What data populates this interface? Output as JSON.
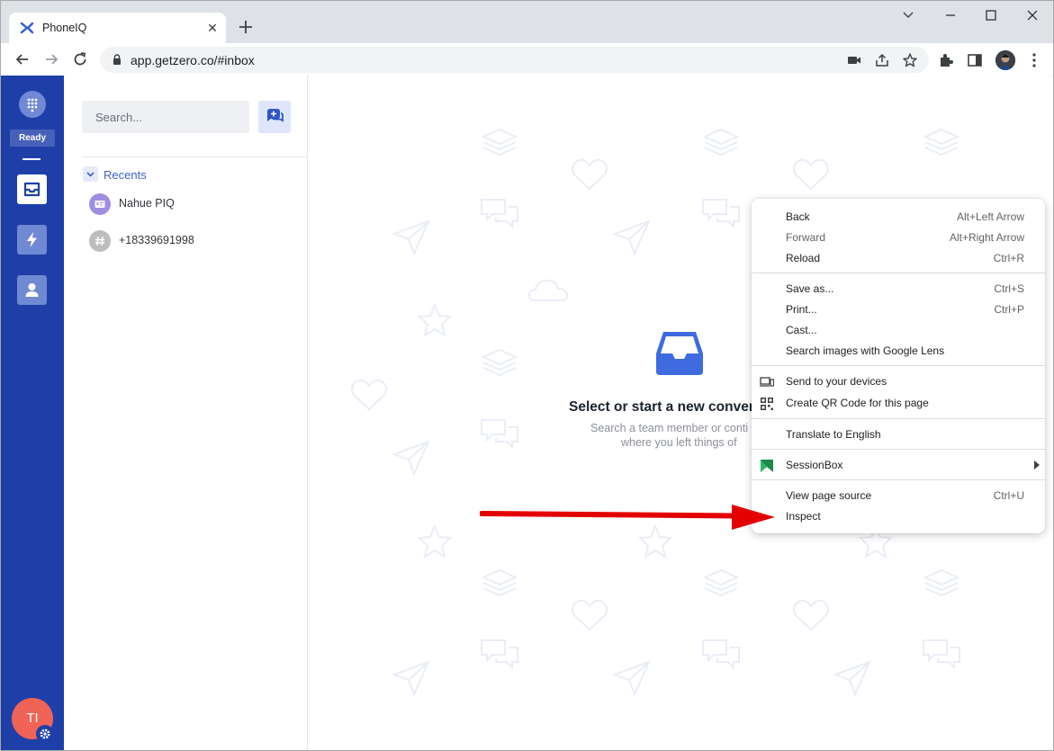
{
  "browser": {
    "tab_title": "PhoneIQ",
    "url": "app.getzero.co/#inbox"
  },
  "rail": {
    "status": "Ready",
    "user_initials": "TI"
  },
  "sidebar": {
    "search_placeholder": "Search...",
    "recents_label": "Recents",
    "contacts": [
      {
        "name": "Nahue PIQ",
        "avatar_color": "#9f8ee0"
      },
      {
        "name": "+18339691998",
        "avatar_color": "#bdbdbd"
      }
    ]
  },
  "main": {
    "empty_title": "Select or start a new conver",
    "empty_sub_line1": "Search a team member or conti",
    "empty_sub_line2": "where you left things of"
  },
  "context_menu": {
    "items": [
      {
        "label": "Back",
        "shortcut": "Alt+Left Arrow"
      },
      {
        "label": "Forward",
        "shortcut": "Alt+Right Arrow",
        "disabled": true
      },
      {
        "label": "Reload",
        "shortcut": "Ctrl+R"
      },
      {
        "label": "Save as...",
        "shortcut": "Ctrl+S"
      },
      {
        "label": "Print...",
        "shortcut": "Ctrl+P"
      },
      {
        "label": "Cast...",
        "shortcut": ""
      },
      {
        "label": "Search images with Google Lens",
        "shortcut": ""
      },
      {
        "label": "Send to your devices",
        "shortcut": "",
        "icon": "devices-icon"
      },
      {
        "label": "Create QR Code for this page",
        "shortcut": "",
        "icon": "qr-code-icon"
      },
      {
        "label": "Translate to English",
        "shortcut": ""
      },
      {
        "label": "SessionBox",
        "shortcut": "",
        "icon": "sessionbox-icon"
      },
      {
        "label": "View page source",
        "shortcut": "Ctrl+U"
      },
      {
        "label": "Inspect",
        "shortcut": ""
      }
    ]
  },
  "colors": {
    "rail": "#1f3fa8",
    "accent": "#3d5fc4",
    "avatar": "#f06357",
    "annotation_arrow": "#e30000"
  }
}
